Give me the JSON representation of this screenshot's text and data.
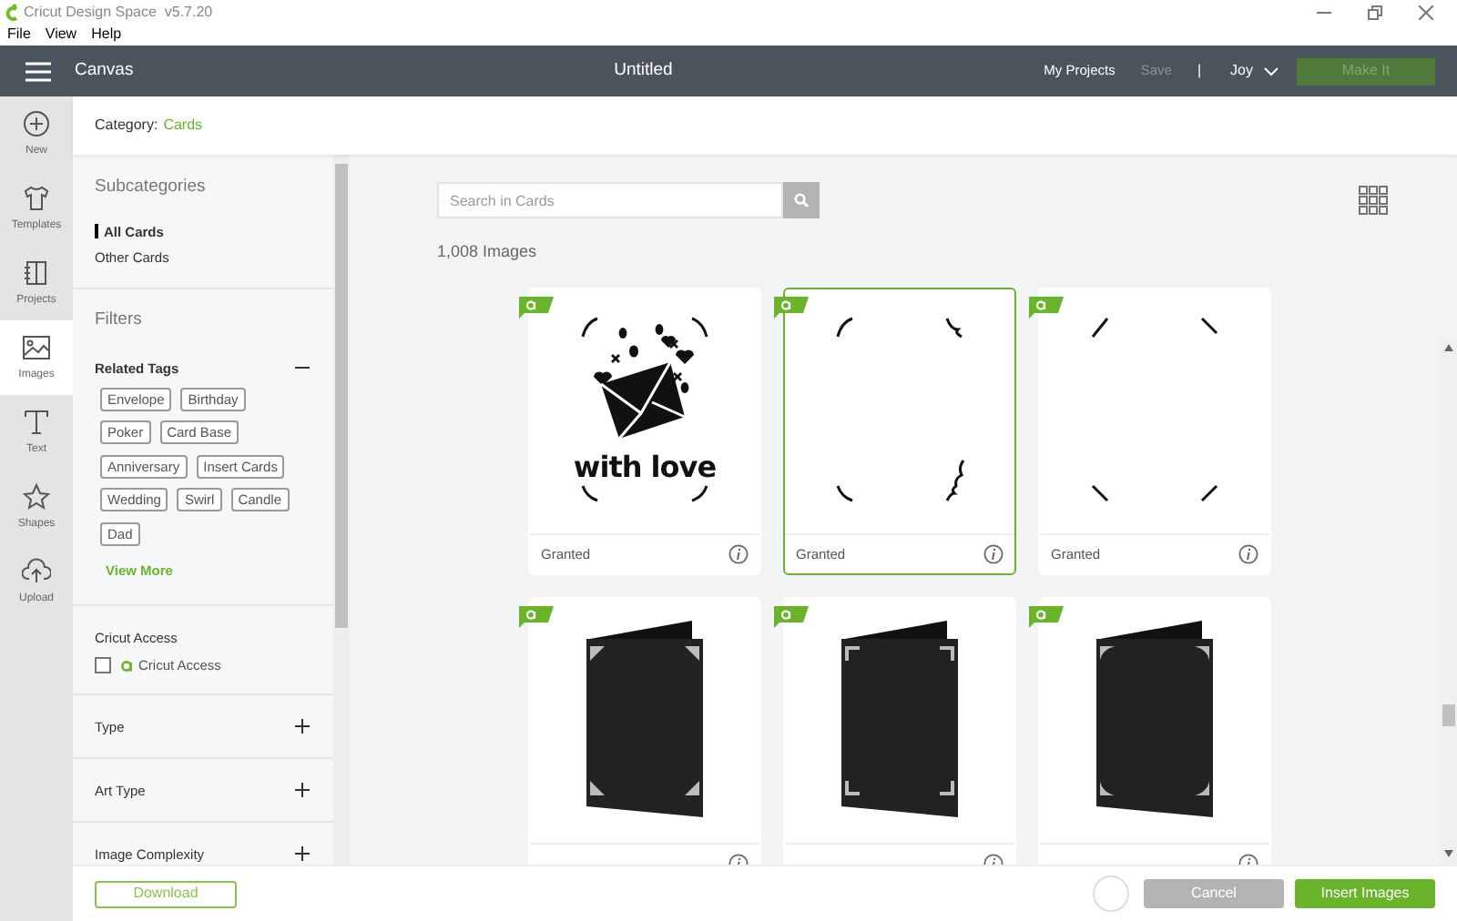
{
  "window": {
    "title": "Cricut Design Space  v5.7.20"
  },
  "menu": [
    "File",
    "View",
    "Help"
  ],
  "header": {
    "section": "Canvas",
    "document": "Untitled",
    "links": [
      {
        "label": "My Projects",
        "disabled": false
      },
      {
        "label": "Save",
        "disabled": true
      }
    ],
    "separator": "|",
    "user": "Joy",
    "action": {
      "label": "Make It",
      "disabled": true
    }
  },
  "nav": [
    {
      "label": "New",
      "kind": "new",
      "selected": false
    },
    {
      "label": "Templates",
      "kind": "templates",
      "selected": false
    },
    {
      "label": "Projects",
      "kind": "projects",
      "selected": false
    },
    {
      "label": "Images",
      "kind": "images",
      "selected": true
    },
    {
      "label": "Text",
      "kind": "text",
      "selected": false
    },
    {
      "label": "Shapes",
      "kind": "shapes",
      "selected": false
    },
    {
      "label": "Upload",
      "kind": "upload",
      "selected": false
    }
  ],
  "category": {
    "label": "Category:",
    "value": "Cards"
  },
  "subcategories": {
    "title": "Subcategories",
    "items": [
      {
        "label": "All Cards",
        "selected": true
      },
      {
        "label": "Other Cards",
        "selected": false
      }
    ]
  },
  "filters": {
    "title": "Filters",
    "related_tags": {
      "title": "Related Tags",
      "expanded": true,
      "tag_rows": [
        [
          "Envelope",
          "Birthday"
        ],
        [
          "Poker",
          "Card Base"
        ],
        [
          "Anniversary",
          "Insert Cards"
        ],
        [
          "Wedding",
          "Swirl",
          "Candle"
        ],
        [
          "Dad"
        ]
      ],
      "more": "View More"
    },
    "access": {
      "title": "Cricut Access",
      "label": "Cricut Access",
      "checked": false
    },
    "sections": [
      {
        "title": "Type",
        "expanded": false
      },
      {
        "title": "Art Type",
        "expanded": false
      },
      {
        "title": "Image Complexity",
        "expanded": false
      }
    ]
  },
  "search": {
    "placeholder": "Search in Cards"
  },
  "count": "1,008 Images",
  "images": [
    {
      "kind": "love-envelope",
      "art_text": "with love",
      "label": "Granted",
      "selected": false,
      "access": true
    },
    {
      "kind": "corner-arcs",
      "label": "Granted",
      "selected": true,
      "access": true
    },
    {
      "kind": "corner-lines",
      "label": "Granted",
      "selected": false,
      "access": true
    },
    {
      "kind": "folded-card",
      "selected": false,
      "access": true
    },
    {
      "kind": "folded-card-brackets",
      "selected": false,
      "access": true
    },
    {
      "kind": "folded-card-rounded",
      "selected": false,
      "access": true
    }
  ],
  "footer": {
    "download": "Download",
    "cancel": "Cancel",
    "insert": "Insert Images"
  }
}
